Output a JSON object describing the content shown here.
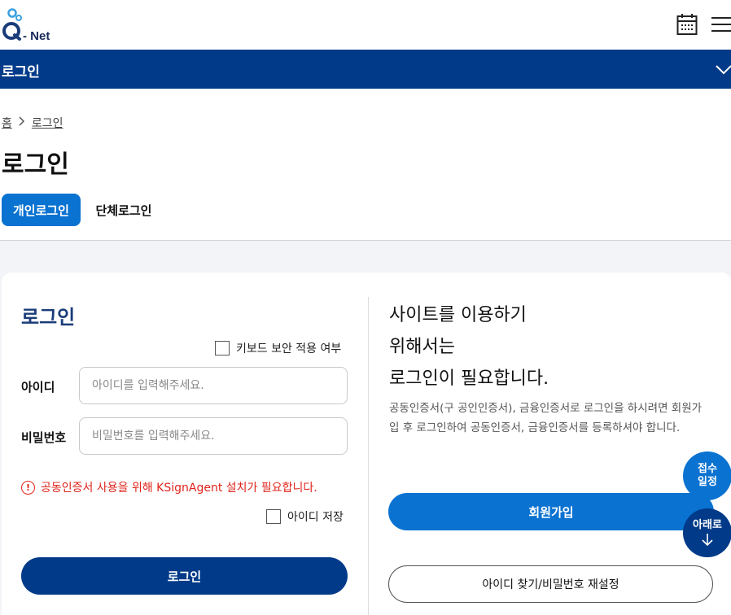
{
  "header": {
    "logo_text": "- Net",
    "calendar_icon": "calendar-icon",
    "menu_icon": "hamburger-icon"
  },
  "navbar": {
    "title": "로그인",
    "chevron_icon": "chevron-down-icon"
  },
  "breadcrumb": {
    "home": "홈",
    "separator_icon": "chevron-right-icon",
    "current": "로그인"
  },
  "page_title": "로그인",
  "tabs": [
    {
      "label": "개인로그인",
      "active": true
    },
    {
      "label": "단체로그인",
      "active": false
    }
  ],
  "login_form": {
    "heading": "로그인",
    "keyboard_security_label": "키보드 보안 적용 여부",
    "id_label": "아이디",
    "id_placeholder": "아이디를 입력해주세요.",
    "password_label": "비밀번호",
    "password_placeholder": "비밀번호를 입력해주세요.",
    "warning_text": "공동인증서 사용을 위해 KSignAgent 설치가 필요합니다.",
    "warning_icon": "!",
    "save_id_label": "아이디 저장",
    "login_button": "로그인"
  },
  "info_panel": {
    "heading_lines": [
      "사이트를 이용하기",
      "위해서는",
      "로그인이 필요합니다."
    ],
    "description": "공동인증서(구 공인인증서), 금융인증서로 로그인을 하시려면 회원가입 후 로그인하여 공동인증서, 금융인증서를 등록하셔야 합니다.",
    "join_button": "회원가입",
    "find_button": "아이디 찾기/비밀번호 재설정"
  },
  "floating": {
    "schedule_line1": "접수",
    "schedule_line2": "일정",
    "down_label": "아래로",
    "down_icon": "arrow-down-icon"
  },
  "colors": {
    "navy": "#003a88",
    "blue": "#0a72d1",
    "warning_red": "#e0241b"
  }
}
